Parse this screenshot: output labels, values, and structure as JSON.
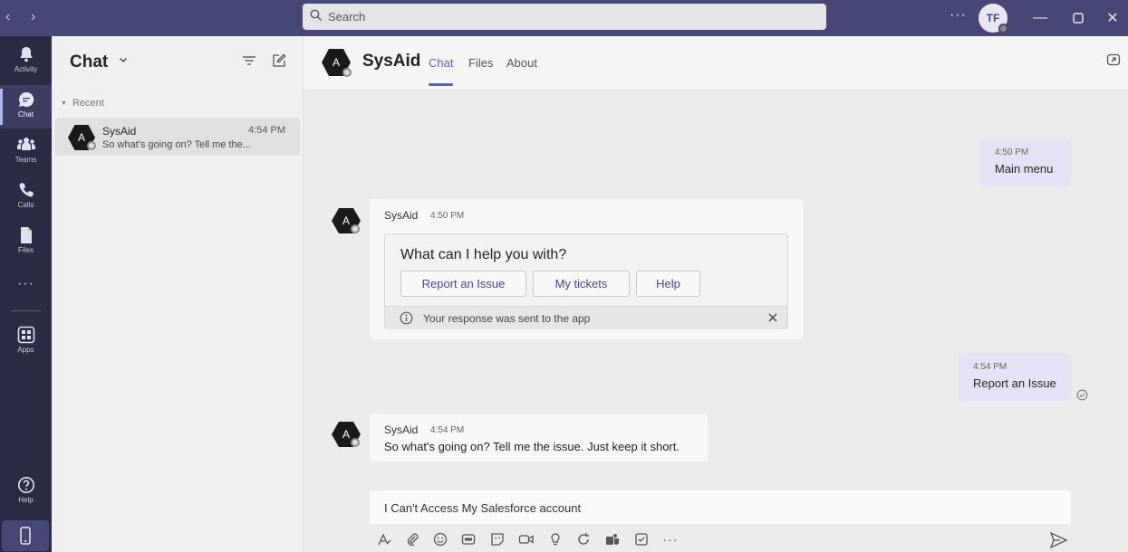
{
  "search": {
    "placeholder": "Search"
  },
  "user": {
    "initials": "TF"
  },
  "rail": {
    "items": [
      {
        "label": "Activity"
      },
      {
        "label": "Chat"
      },
      {
        "label": "Teams"
      },
      {
        "label": "Calls"
      },
      {
        "label": "Files"
      },
      {
        "label": "Apps"
      },
      {
        "label": "Help"
      }
    ],
    "more": "···"
  },
  "chat_list": {
    "title": "Chat",
    "section": "Recent",
    "items": [
      {
        "avatar": "A",
        "name": "SysAid",
        "time": "4:54 PM",
        "preview": "So what's going on? Tell me the..."
      }
    ]
  },
  "conversation": {
    "avatar": "A",
    "name": "SysAid",
    "tabs": [
      "Chat",
      "Files",
      "About"
    ],
    "messages": [
      {
        "time": "4:50 PM",
        "text": "Main menu"
      },
      {
        "sender": "SysAid",
        "time": "4:50 PM",
        "card": {
          "title": "What can I help you with?",
          "buttons": [
            "Report an Issue",
            "My tickets",
            "Help"
          ],
          "note": "Your response was sent to the app"
        }
      },
      {
        "time": "4:54 PM",
        "text": "Report an Issue"
      },
      {
        "sender": "SysAid",
        "time": "4:54 PM",
        "text": "So what's going on? Tell me the issue. Just keep it short."
      }
    ],
    "compose_value": "I Can't Access My Salesforce account"
  }
}
